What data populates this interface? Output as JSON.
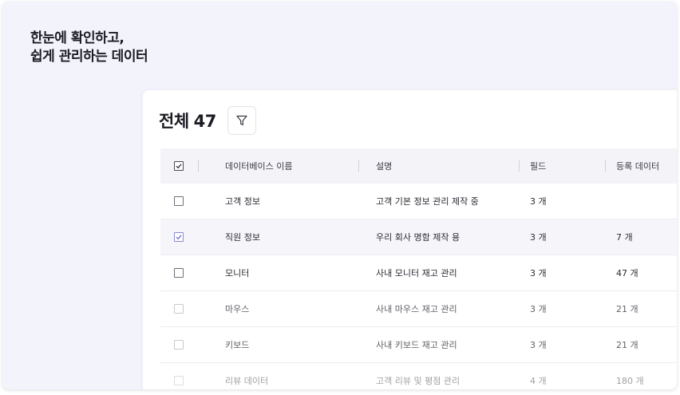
{
  "headline": {
    "line1": "한눈에 확인하고,",
    "line2": "쉽게 관리하는 데이터"
  },
  "panel": {
    "total_label": "전체",
    "total_count": "47",
    "filter_icon": "filter-icon"
  },
  "table": {
    "columns": [
      "데이터베이스 이름",
      "설명",
      "필드",
      "등록 데이터"
    ],
    "rows": [
      {
        "name": "고객 정보",
        "desc": "고객 기본 정보 관리 제작 중",
        "fields": "3 개",
        "records": "",
        "checked": false
      },
      {
        "name": "직원 정보",
        "desc": "우리 회사 명함 제작 용",
        "fields": "3 개",
        "records": "7 개",
        "checked": true
      },
      {
        "name": "모니터",
        "desc": "사내 모니터 재고 관리",
        "fields": "3 개",
        "records": "47 개",
        "checked": false
      },
      {
        "name": "마우스",
        "desc": "사내 마우스 재고 관리",
        "fields": "3 개",
        "records": "21 개",
        "checked": false
      },
      {
        "name": "키보드",
        "desc": "사내 키보드 재고 관리",
        "fields": "3 개",
        "records": "21 개",
        "checked": false
      },
      {
        "name": "리뷰 데이터",
        "desc": "고객 리뷰 및 평점 관리",
        "fields": "4 개",
        "records": "180 개",
        "checked": false
      }
    ]
  },
  "colors": {
    "background": "#f3f3fc",
    "panel": "#ffffff",
    "header_row": "#f4f4f8",
    "selected_row": "#f6f6fa",
    "accent_check": "#6a6ad0"
  }
}
